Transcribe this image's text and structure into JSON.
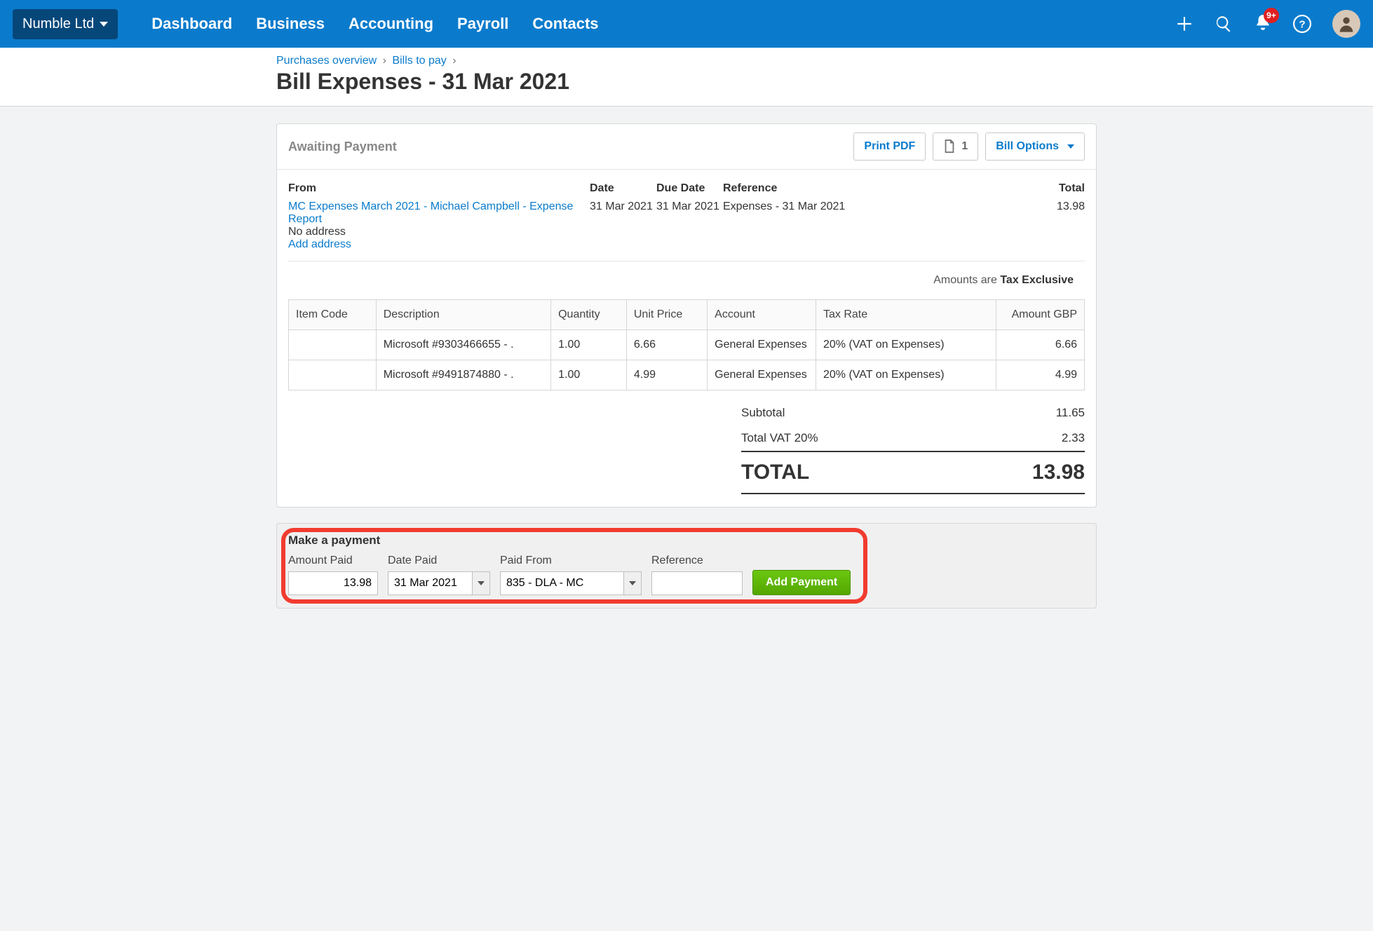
{
  "nav": {
    "org": "Numble Ltd",
    "links": [
      "Dashboard",
      "Business",
      "Accounting",
      "Payroll",
      "Contacts"
    ],
    "badge": "9+"
  },
  "breadcrumb": {
    "a": "Purchases overview",
    "b": "Bills to pay"
  },
  "page_title": "Bill Expenses - 31 Mar 2021",
  "status": "Awaiting Payment",
  "actions": {
    "print": "Print PDF",
    "file_count": "1",
    "options": "Bill Options"
  },
  "headers": {
    "from": "From",
    "date": "Date",
    "due": "Due Date",
    "ref": "Reference",
    "total": "Total"
  },
  "bill": {
    "from_link": "MC Expenses March 2021 - Michael Campbell - Expense Report",
    "no_address": "No address",
    "add_address": "Add address",
    "date": "31 Mar 2021",
    "due": "31 Mar 2021",
    "reference": "Expenses - 31 Mar 2021",
    "total": "13.98"
  },
  "amounts_note_prefix": "Amounts are ",
  "amounts_note_value": "Tax Exclusive",
  "item_headers": {
    "code": "Item Code",
    "desc": "Description",
    "qty": "Quantity",
    "unit": "Unit Price",
    "account": "Account",
    "tax": "Tax Rate",
    "amount": "Amount GBP"
  },
  "items": [
    {
      "code": "",
      "desc": "Microsoft #9303466655 - .",
      "qty": "1.00",
      "unit": "6.66",
      "account": "General Expenses",
      "tax": "20% (VAT on Expenses)",
      "amount": "6.66"
    },
    {
      "code": "",
      "desc": "Microsoft #9491874880 - .",
      "qty": "1.00",
      "unit": "4.99",
      "account": "General Expenses",
      "tax": "20% (VAT on Expenses)",
      "amount": "4.99"
    }
  ],
  "totals": {
    "subtotal_label": "Subtotal",
    "subtotal": "11.65",
    "vat_label": "Total VAT  20%",
    "vat": "2.33",
    "grand_label": "TOTAL",
    "grand": "13.98"
  },
  "payment": {
    "title": "Make a payment",
    "labels": {
      "amount": "Amount Paid",
      "date": "Date Paid",
      "from": "Paid From",
      "ref": "Reference"
    },
    "values": {
      "amount": "13.98",
      "date": "31 Mar 2021",
      "from": "835 - DLA - MC",
      "ref": ""
    },
    "button": "Add Payment"
  }
}
